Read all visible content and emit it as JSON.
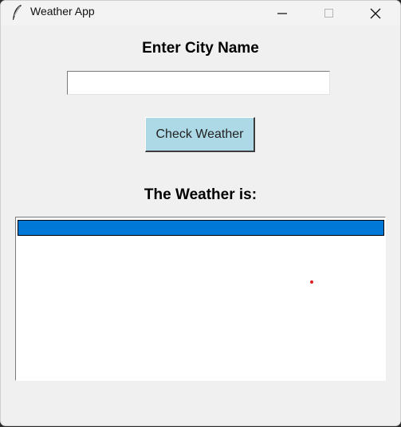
{
  "window": {
    "title": "Weather App",
    "icon": "feather-icon",
    "controls": [
      "minimize-icon",
      "maximize-icon",
      "close-icon"
    ]
  },
  "form": {
    "city_label": "Enter City Name",
    "city_value": "",
    "city_placeholder": "",
    "check_button_label": "Check Weather",
    "button_color": "#add8e6"
  },
  "result": {
    "heading": "The Weather is:",
    "text": "",
    "highlight_color": "#0078d7"
  }
}
